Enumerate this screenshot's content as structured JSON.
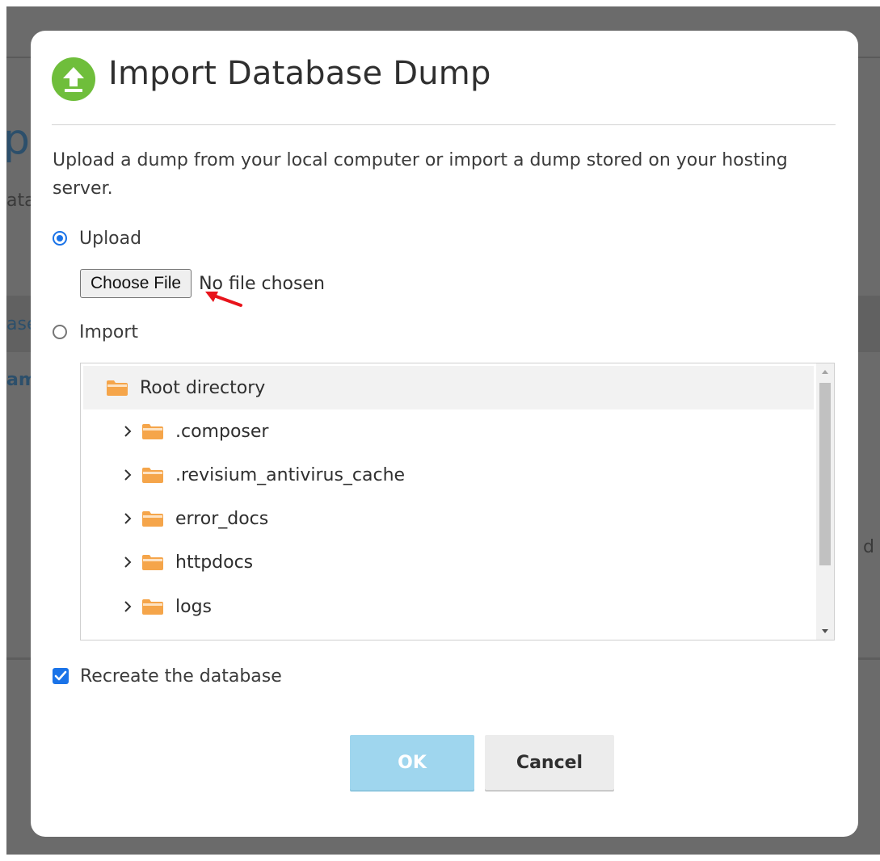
{
  "background": {
    "fragments": [
      "p",
      "ata",
      "ase",
      "am",
      "d R"
    ]
  },
  "dialog": {
    "title": "Import Database Dump",
    "header_icon": "upload-arrow-icon",
    "intro": "Upload a dump from your local computer or import a dump stored on your hosting server.",
    "upload": {
      "label": "Upload",
      "checked": true,
      "choose_file_label": "Choose File",
      "file_status": "No file chosen"
    },
    "import": {
      "label": "Import",
      "checked": false
    },
    "tree": {
      "root": "Root directory",
      "items": [
        {
          "label": ".composer"
        },
        {
          "label": ".revisium_antivirus_cache"
        },
        {
          "label": "error_docs"
        },
        {
          "label": "httpdocs"
        },
        {
          "label": "logs"
        }
      ]
    },
    "recreate": {
      "label": "Recreate the database",
      "checked": true
    },
    "buttons": {
      "ok": "OK",
      "cancel": "Cancel"
    }
  },
  "colors": {
    "accent": "#1a73e8",
    "header_icon_bg": "#6fbe3b",
    "ok_disabled": "#9fd6ee",
    "folder": "#f5a54a",
    "annotation_arrow": "#e8141b"
  }
}
